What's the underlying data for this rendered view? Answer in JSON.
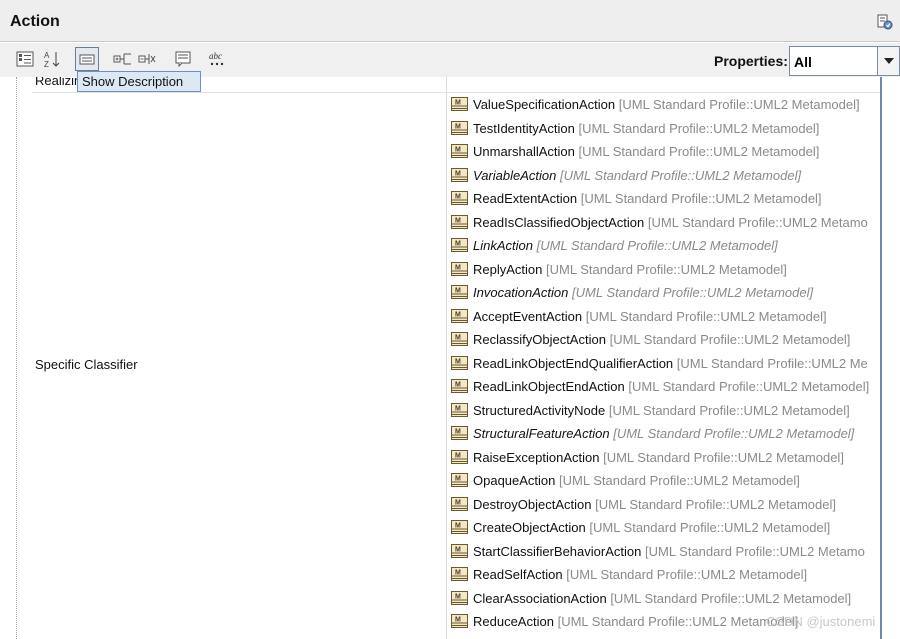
{
  "panel": {
    "title": "Action",
    "header_icon": "panel-settings-icon"
  },
  "toolbar": {
    "buttons": [
      {
        "name": "categorized-view-icon",
        "pressed": false
      },
      {
        "name": "sort-alphabetically-icon",
        "pressed": false
      },
      {
        "name": "show-description-icon",
        "pressed": true
      },
      {
        "name": "expand-all-icon",
        "pressed": false
      },
      {
        "name": "collapse-all-icon",
        "pressed": false
      },
      {
        "name": "comment-icon",
        "pressed": false
      },
      {
        "name": "spelling-icon",
        "pressed": false
      }
    ],
    "tooltip": "Show Description",
    "properties_label": "Properties:",
    "properties_value": "All"
  },
  "grid": {
    "rows": [
      {
        "name": "Realizin"
      },
      {
        "name": "Specific Classifier",
        "values": [
          {
            "name": "ValueSpecificationAction",
            "owner": "[UML Standard Profile::UML2 Metamodel]",
            "abstract": false
          },
          {
            "name": "TestIdentityAction",
            "owner": "[UML Standard Profile::UML2 Metamodel]",
            "abstract": false
          },
          {
            "name": "UnmarshallAction",
            "owner": "[UML Standard Profile::UML2 Metamodel]",
            "abstract": false
          },
          {
            "name": "VariableAction",
            "owner": "[UML Standard Profile::UML2 Metamodel]",
            "abstract": true
          },
          {
            "name": "ReadExtentAction",
            "owner": "[UML Standard Profile::UML2 Metamodel]",
            "abstract": false
          },
          {
            "name": "ReadIsClassifiedObjectAction",
            "owner": "[UML Standard Profile::UML2 Metamo",
            "abstract": false
          },
          {
            "name": "LinkAction",
            "owner": "[UML Standard Profile::UML2 Metamodel]",
            "abstract": true
          },
          {
            "name": "ReplyAction",
            "owner": "[UML Standard Profile::UML2 Metamodel]",
            "abstract": false
          },
          {
            "name": "InvocationAction",
            "owner": "[UML Standard Profile::UML2 Metamodel]",
            "abstract": true
          },
          {
            "name": "AcceptEventAction",
            "owner": "[UML Standard Profile::UML2 Metamodel]",
            "abstract": false
          },
          {
            "name": "ReclassifyObjectAction",
            "owner": "[UML Standard Profile::UML2 Metamodel]",
            "abstract": false
          },
          {
            "name": "ReadLinkObjectEndQualifierAction",
            "owner": "[UML Standard Profile::UML2 Me",
            "abstract": false
          },
          {
            "name": "ReadLinkObjectEndAction",
            "owner": "[UML Standard Profile::UML2 Metamodel]",
            "abstract": false
          },
          {
            "name": "StructuredActivityNode",
            "owner": "[UML Standard Profile::UML2 Metamodel]",
            "abstract": false
          },
          {
            "name": "StructuralFeatureAction",
            "owner": "[UML Standard Profile::UML2 Metamodel]",
            "abstract": true
          },
          {
            "name": "RaiseExceptionAction",
            "owner": "[UML Standard Profile::UML2 Metamodel]",
            "abstract": false
          },
          {
            "name": "OpaqueAction",
            "owner": "[UML Standard Profile::UML2 Metamodel]",
            "abstract": false
          },
          {
            "name": "DestroyObjectAction",
            "owner": "[UML Standard Profile::UML2 Metamodel]",
            "abstract": false
          },
          {
            "name": "CreateObjectAction",
            "owner": "[UML Standard Profile::UML2 Metamodel]",
            "abstract": false
          },
          {
            "name": "StartClassifierBehaviorAction",
            "owner": "[UML Standard Profile::UML2 Metamo",
            "abstract": false
          },
          {
            "name": "ReadSelfAction",
            "owner": "[UML Standard Profile::UML2 Metamodel]",
            "abstract": false
          },
          {
            "name": "ClearAssociationAction",
            "owner": "[UML Standard Profile::UML2 Metamodel]",
            "abstract": false
          },
          {
            "name": "ReduceAction",
            "owner": "[UML Standard Profile::UML2 Metamodel]",
            "abstract": false
          }
        ]
      }
    ]
  },
  "watermark": "CSDN @justonemi",
  "colors": {
    "scrollbar": "#6f89b3",
    "owner_text": "#8a8a8a",
    "tooltip_bg": "#dde8f5"
  }
}
